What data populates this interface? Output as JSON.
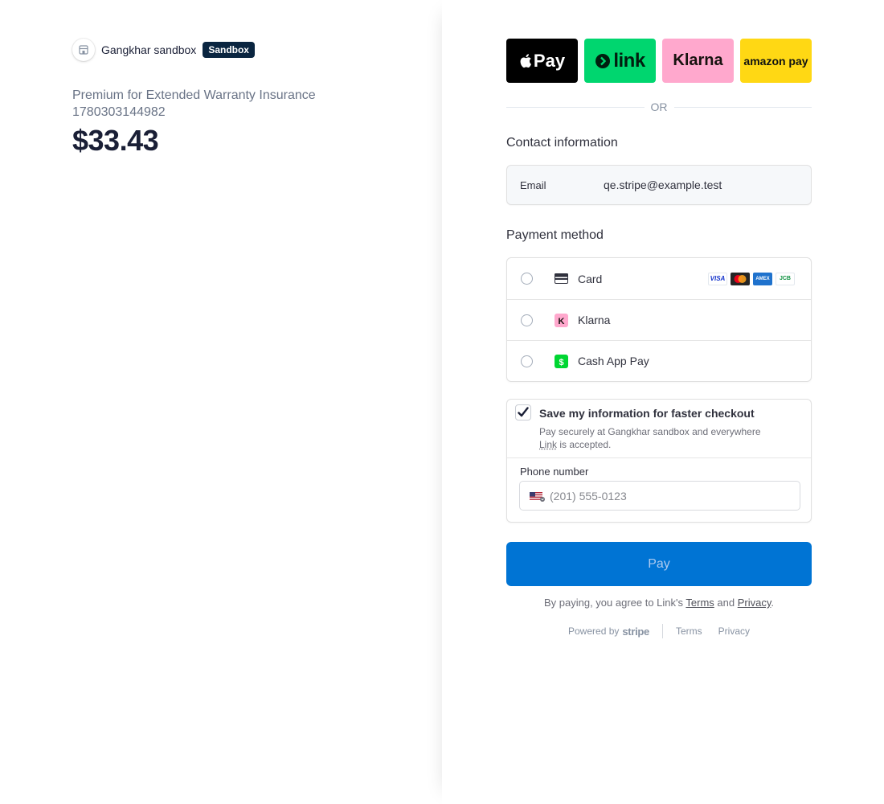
{
  "merchant": {
    "name": "Gangkhar sandbox",
    "badge": "Sandbox"
  },
  "summary": {
    "product_name": "Premium for Extended Warranty Insurance 1780303144982",
    "amount": "$33.43"
  },
  "wallets": {
    "apple_pay": "Pay",
    "link": "link",
    "klarna": "Klarna",
    "amazon_pay": "amazon pay"
  },
  "divider": "OR",
  "contact": {
    "title": "Contact information",
    "email_label": "Email",
    "email_value": "qe.stripe@example.test"
  },
  "payment_method": {
    "title": "Payment method",
    "options": [
      {
        "label": "Card",
        "icon": "credit-card-icon"
      },
      {
        "label": "Klarna",
        "icon": "klarna-icon"
      },
      {
        "label": "Cash App Pay",
        "icon": "cash-app-icon"
      }
    ],
    "card_brands": [
      "VISA",
      "Mastercard",
      "AMEX",
      "JCB"
    ]
  },
  "link_save": {
    "title": "Save my information for faster checkout",
    "desc_before": "Pay securely at Gangkhar sandbox and everywhere",
    "desc_link": "Link",
    "desc_after": " is accepted.",
    "checked": true,
    "phone_label": "Phone number",
    "phone_placeholder": "(201) 555-0123"
  },
  "pay": {
    "label": "Pay",
    "agree_prefix": "By paying, you agree to Link's ",
    "agree_terms": "Terms",
    "agree_and": " and ",
    "agree_privacy": "Privacy",
    "agree_suffix": "."
  },
  "footer": {
    "powered_by": "Powered by",
    "stripe": "stripe",
    "terms": "Terms",
    "privacy": "Privacy"
  },
  "colors": {
    "pay_button": "#0074d4",
    "link_green": "#00d66f",
    "klarna_pink": "#ffa8cd",
    "amazon_yellow": "#ffd814",
    "badge": "#0a2540"
  }
}
